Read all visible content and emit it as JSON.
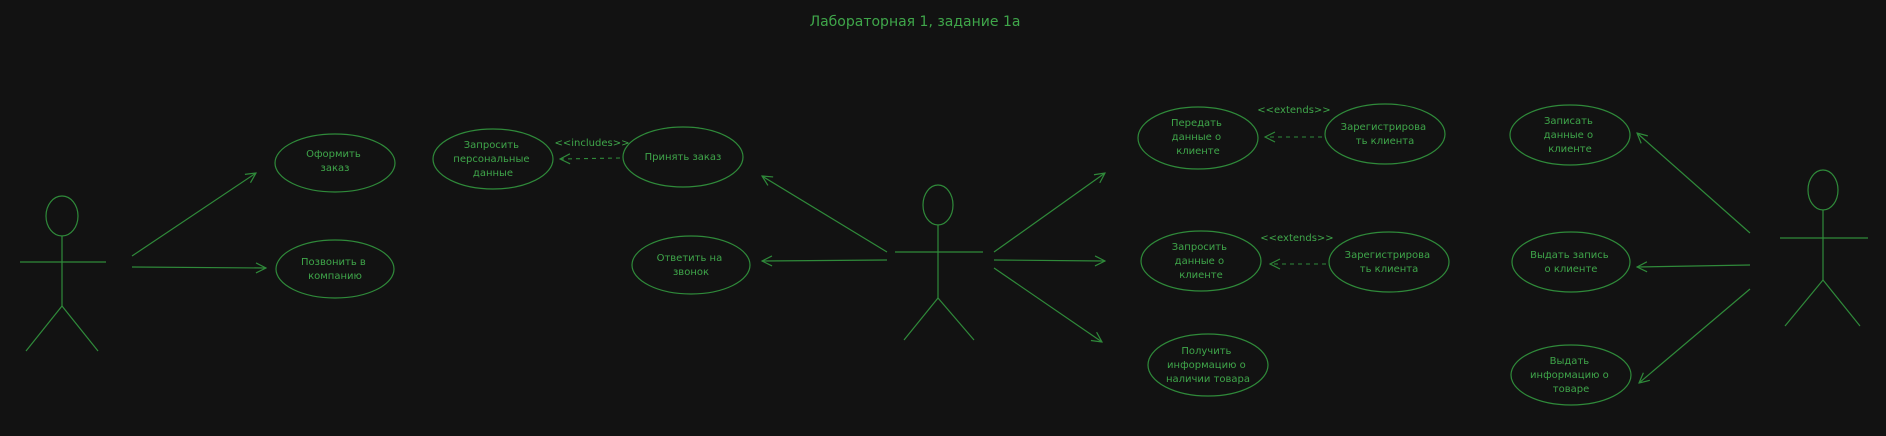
{
  "title": "Лабораторная 1, задание 1а",
  "use_cases": {
    "place_order": [
      "Оформить",
      "заказ"
    ],
    "call_company": [
      "Позвонить в",
      "компанию"
    ],
    "request_personal_data": [
      "Запросить",
      "персональные",
      "данные"
    ],
    "accept_order": [
      "Принять заказ"
    ],
    "answer_call": [
      "Ответить на",
      "звонок"
    ],
    "transfer_client_data": [
      "Передать",
      "данные о",
      "клиенте"
    ],
    "register_client_1": [
      "Зарегистрирова",
      "ть клиента"
    ],
    "request_client_data": [
      "Запросить",
      "данные о",
      "клиенте"
    ],
    "register_client_2": [
      "Зарегистрирова",
      "ть клиента"
    ],
    "get_stock_info": [
      "Получить",
      "информацию о",
      "наличии товара"
    ],
    "record_client_data": [
      "Записать",
      "данные о",
      "клиенте"
    ],
    "issue_client_record": [
      "Выдать запись",
      "о клиенте"
    ],
    "issue_product_info": [
      "Выдать",
      "информацию о",
      "товаре"
    ]
  },
  "stereotypes": {
    "includes": "<<includes>>",
    "extends_1": "<<extends>>",
    "extends_2": "<<extends>>"
  },
  "colors": {
    "background": "#121212",
    "stroke": "#2f8a3a",
    "text": "#3fa64a"
  }
}
